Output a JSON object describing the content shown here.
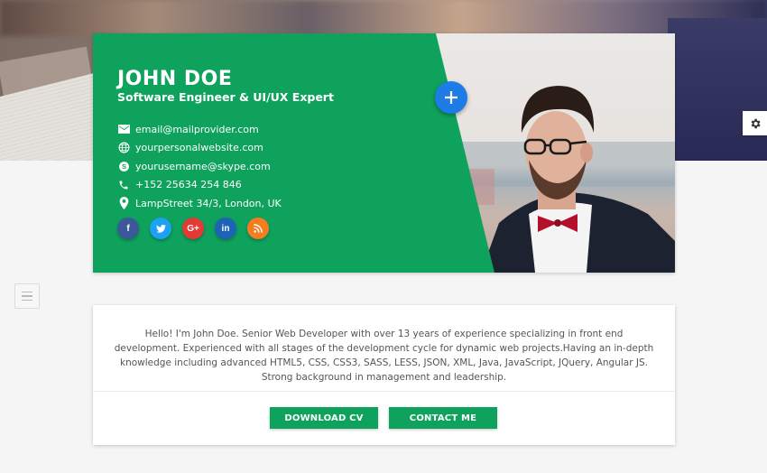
{
  "profile": {
    "name": "JOHN DOE",
    "role": "Software Engineer & UI/UX Expert",
    "contacts": [
      {
        "icon": "email-icon",
        "text": "email@mailprovider.com"
      },
      {
        "icon": "globe-icon",
        "text": "yourpersonalwebsite.com"
      },
      {
        "icon": "skype-icon",
        "text": "yourusername@skype.com"
      },
      {
        "icon": "phone-icon",
        "text": "+152 25634 254 846"
      },
      {
        "icon": "location-pin-icon",
        "text": "LampStreet 34/3, London, UK"
      }
    ],
    "socials": [
      {
        "name": "facebook",
        "glyph": "f",
        "color": "#3b5998"
      },
      {
        "name": "twitter",
        "glyph": "t",
        "color": "#1da1f2"
      },
      {
        "name": "google-plus",
        "glyph": "G+",
        "color": "#e53935"
      },
      {
        "name": "linkedin",
        "glyph": "in",
        "color": "#1e63b5"
      },
      {
        "name": "rss",
        "glyph": "rss",
        "color": "#f57c1f"
      }
    ],
    "fab_icon": "plus-icon"
  },
  "about": {
    "text": "Hello! I'm John Doe. Senior Web Developer with over 13 years of experience specializing in front end development. Experienced with all stages of the development cycle for dynamic web projects.Having an in-depth knowledge including advanced HTML5, CSS, CSS3, SASS, LESS, JSON, XML, Java, JavaScript, JQuery, Angular JS. Strong background in management and leadership."
  },
  "actions": {
    "download_label": "DOWNLOAD CV",
    "contact_label": "CONTACT ME"
  },
  "colors": {
    "accent": "#0ea25d",
    "fab": "#1e7ce6"
  }
}
